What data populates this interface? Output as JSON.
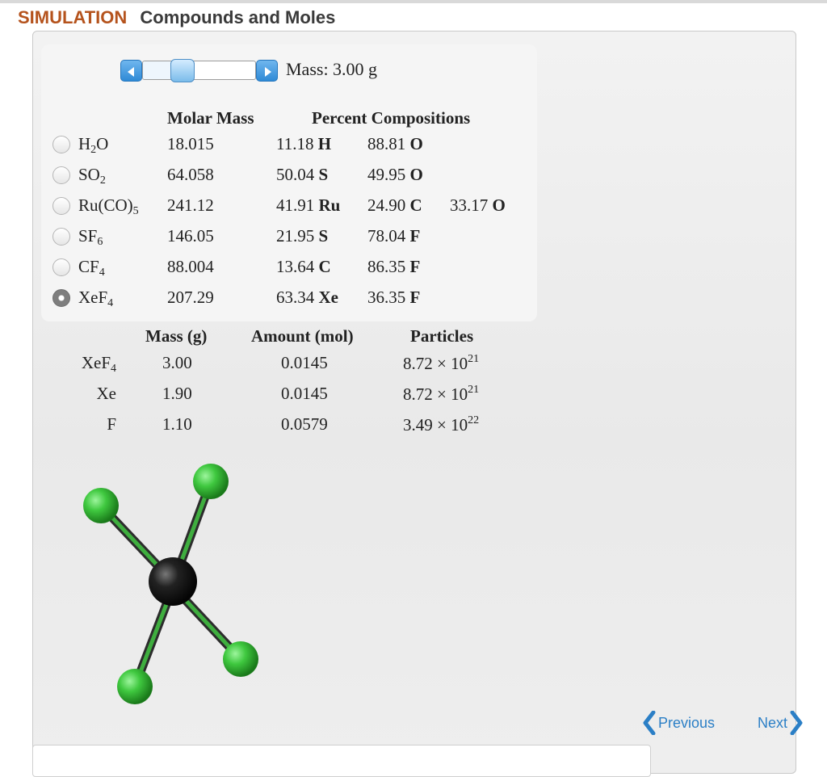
{
  "header": {
    "kind": "SIMULATION",
    "title": "Compounds and Moles"
  },
  "slider": {
    "label": "Mass: 3.00 g",
    "position_fraction": 0.05
  },
  "compounds_table": {
    "headers": {
      "molar_mass": "Molar Mass",
      "percent": "Percent Compositions"
    },
    "rows": [
      {
        "formula_base": "H",
        "formula_sub": "2",
        "formula_tail": "O",
        "sub2": "",
        "molar_mass": "18.015",
        "p1": "11.18",
        "e1": "H",
        "p2": "88.81",
        "e2": "O",
        "p3": "",
        "e3": "",
        "selected": false
      },
      {
        "formula_base": "SO",
        "formula_sub": "2",
        "formula_tail": "",
        "sub2": "",
        "molar_mass": "64.058",
        "p1": "50.04",
        "e1": "S",
        "p2": "49.95",
        "e2": "O",
        "p3": "",
        "e3": "",
        "selected": false
      },
      {
        "formula_base": "Ru(CO)",
        "formula_sub": "5",
        "formula_tail": "",
        "sub2": "",
        "molar_mass": "241.12",
        "p1": "41.91",
        "e1": "Ru",
        "p2": "24.90",
        "e2": "C",
        "p3": "33.17",
        "e3": "O",
        "selected": false
      },
      {
        "formula_base": "SF",
        "formula_sub": "6",
        "formula_tail": "",
        "sub2": "",
        "molar_mass": "146.05",
        "p1": "21.95",
        "e1": "S",
        "p2": "78.04",
        "e2": "F",
        "p3": "",
        "e3": "",
        "selected": false
      },
      {
        "formula_base": "CF",
        "formula_sub": "4",
        "formula_tail": "",
        "sub2": "",
        "molar_mass": "88.004",
        "p1": "13.64",
        "e1": "C",
        "p2": "86.35",
        "e2": "F",
        "p3": "",
        "e3": "",
        "selected": false
      },
      {
        "formula_base": "XeF",
        "formula_sub": "4",
        "formula_tail": "",
        "sub2": "",
        "molar_mass": "207.29",
        "p1": "63.34",
        "e1": "Xe",
        "p2": "36.35",
        "e2": "F",
        "p3": "",
        "e3": "",
        "selected": true
      }
    ]
  },
  "results_table": {
    "headers": {
      "mass": "Mass (g)",
      "amount": "Amount (mol)",
      "particles": "Particles"
    },
    "rows": [
      {
        "label_base": "XeF",
        "label_sub": "4",
        "mass": "3.00",
        "amount": "0.0145",
        "particles_mant": "8.72 × 10",
        "particles_exp": "21"
      },
      {
        "label_base": "Xe",
        "label_sub": "",
        "mass": "1.90",
        "amount": "0.0145",
        "particles_mant": "8.72 × 10",
        "particles_exp": "21"
      },
      {
        "label_base": "F",
        "label_sub": "",
        "mass": "1.10",
        "amount": "0.0579",
        "particles_mant": "3.49 × 10",
        "particles_exp": "22"
      }
    ]
  },
  "nav": {
    "previous": "Previous",
    "next": "Next"
  },
  "colors": {
    "accent": "#2b7fc6",
    "header_kind": "#b5531d",
    "atom_center": "#1e1e1e",
    "atom_fluorine": "#3fbf3f"
  },
  "molecule": {
    "name": "XeF4 model",
    "center_icon": "xenon-atom",
    "outer_icon": "fluorine-atom"
  }
}
